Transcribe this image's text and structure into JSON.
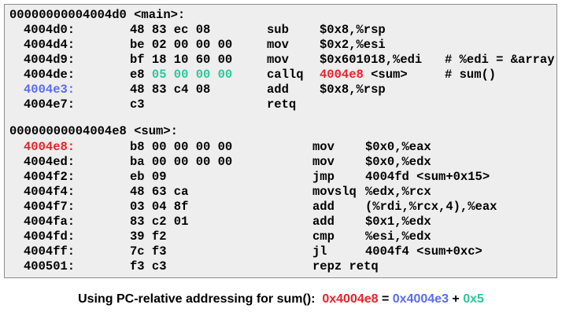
{
  "colors": {
    "target_red": "#e8222a",
    "next_ip_blue": "#5a6cf0",
    "offset_green": "#29c99a",
    "panel_background": "#eeeeee"
  },
  "main_function": {
    "header": "00000000004004d0 <main>:",
    "rows": [
      {
        "addr": "4004d0:",
        "bytes": "48 83 ec 08",
        "mnemonic": "sub",
        "operands": "$0x8,%rsp",
        "comment": ""
      },
      {
        "addr": "4004d4:",
        "bytes": "be 02 00 00 00",
        "mnemonic": "mov",
        "operands": "$0x2,%esi",
        "comment": ""
      },
      {
        "addr": "4004d9:",
        "bytes": "bf 18 10 60 00",
        "mnemonic": "mov",
        "operands": "$0x601018,%edi",
        "comment": "# %edi = &array"
      },
      {
        "addr": "4004de:",
        "bytes_prefix": "e8 ",
        "bytes_highlight": "05 00 00 00",
        "mnemonic": "callq",
        "operands_highlight": "4004e8",
        "operands_rest": " <sum>",
        "comment": "# sum()"
      },
      {
        "addr": "4004e3:",
        "bytes": "48 83 c4 08",
        "mnemonic": "add",
        "operands": "$0x8,%rsp",
        "comment": ""
      },
      {
        "addr": "4004e7:",
        "bytes": "c3",
        "mnemonic": "retq",
        "operands": "",
        "comment": ""
      }
    ]
  },
  "sum_function": {
    "header": "00000000004004e8 <sum>:",
    "rows": [
      {
        "addr": "4004e8:",
        "bytes": "b8 00 00 00 00",
        "mnemonic": "mov",
        "operands": "$0x0,%eax"
      },
      {
        "addr": "4004ed:",
        "bytes": "ba 00 00 00 00",
        "mnemonic": "mov",
        "operands": "$0x0,%edx"
      },
      {
        "addr": "4004f2:",
        "bytes": "eb 09",
        "mnemonic": "jmp",
        "operands": "4004fd <sum+0x15>"
      },
      {
        "addr": "4004f4:",
        "bytes": "48 63 ca",
        "mnemonic": "movslq",
        "operands": "%edx,%rcx"
      },
      {
        "addr": "4004f7:",
        "bytes": "03 04 8f",
        "mnemonic": "add",
        "operands": "(%rdi,%rcx,4),%eax"
      },
      {
        "addr": "4004fa:",
        "bytes": "83 c2 01",
        "mnemonic": "add",
        "operands": "$0x1,%edx"
      },
      {
        "addr": "4004fd:",
        "bytes": "39 f2",
        "mnemonic": "cmp",
        "operands": "%esi,%edx"
      },
      {
        "addr": "4004ff:",
        "bytes": "7c f3",
        "mnemonic": "jl",
        "operands": "4004f4 <sum+0xc>"
      },
      {
        "addr": "400501:",
        "bytes": "f3 c3",
        "mnemonic": "repz retq",
        "operands": ""
      }
    ]
  },
  "caption": {
    "prefix": "Using PC-relative addressing for sum():  ",
    "target": "0x4004e8",
    "equals": " = ",
    "next_ip": "0x4004e3",
    "plus": " + ",
    "offset": "0x5"
  }
}
